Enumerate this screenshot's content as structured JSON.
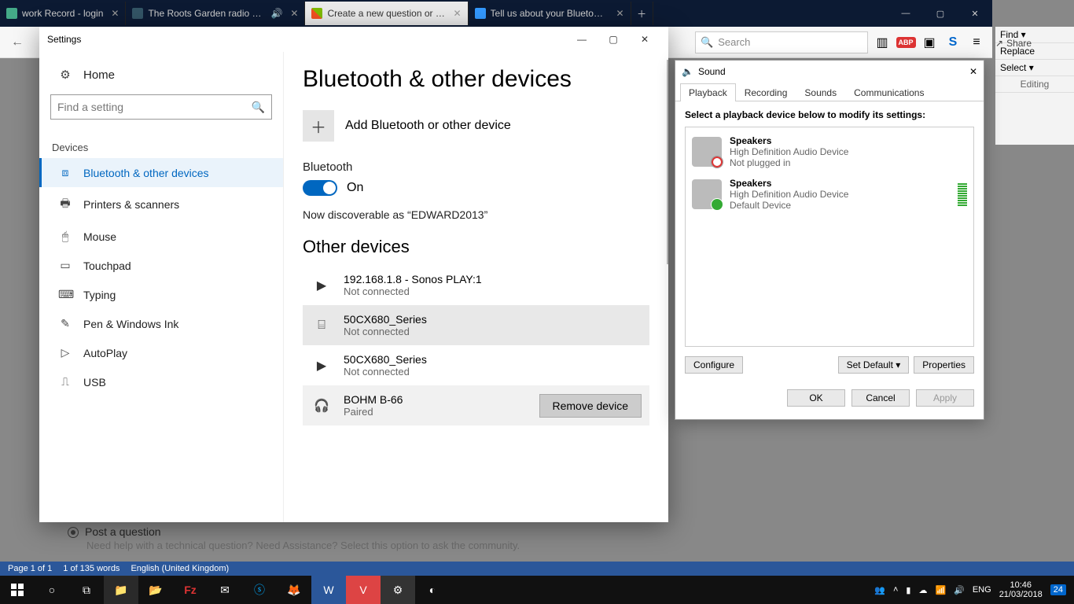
{
  "browser": {
    "tabs": [
      {
        "label": "work Record - login",
        "active": false
      },
      {
        "label": "The Roots Garden radio sho",
        "active": false,
        "audio": true
      },
      {
        "label": "Create a new question or start",
        "active": true
      },
      {
        "label": "Tell us about your Bluetooth pr",
        "active": false
      }
    ],
    "search_placeholder": "Search"
  },
  "word": {
    "share": "Share",
    "find": "Find",
    "replace": "Replace",
    "select": "Select",
    "editing": "Editing",
    "status_page": "Page 1 of 1",
    "status_words": "1 of 135 words",
    "status_lang": "English (United Kingdom)"
  },
  "settings": {
    "title": "Settings",
    "home": "Home",
    "search_placeholder": "Find a setting",
    "section": "Devices",
    "nav": [
      "Bluetooth & other devices",
      "Printers & scanners",
      "Mouse",
      "Touchpad",
      "Typing",
      "Pen & Windows Ink",
      "AutoPlay",
      "USB"
    ],
    "page_heading": "Bluetooth & other devices",
    "add_device": "Add Bluetooth or other device",
    "bt_header": "Bluetooth",
    "bt_state": "On",
    "discoverable": "Now discoverable as “EDWARD2013”",
    "other_header": "Other devices",
    "devices": [
      {
        "name": "192.168.1.8 - Sonos PLAY:1",
        "status": "Not connected"
      },
      {
        "name": "50CX680_Series",
        "status": "Not connected"
      },
      {
        "name": "50CX680_Series",
        "status": "Not connected"
      },
      {
        "name": "BOHM B-66",
        "status": "Paired"
      }
    ],
    "remove": "Remove device"
  },
  "post_question": {
    "title": "Post a question",
    "sub": "Need help with a technical question? Need Assistance? Select this option to ask the community."
  },
  "sound": {
    "title": "Sound",
    "tabs": [
      "Playback",
      "Recording",
      "Sounds",
      "Communications"
    ],
    "instructions": "Select a playback device below to modify its settings:",
    "devices": [
      {
        "name": "Speakers",
        "line2": "High Definition Audio Device",
        "line3": "Not plugged in",
        "badge": "down"
      },
      {
        "name": "Speakers",
        "line2": "High Definition Audio Device",
        "line3": "Default Device",
        "badge": "ok",
        "meter": true
      }
    ],
    "configure": "Configure",
    "setdefault": "Set Default",
    "properties": "Properties",
    "ok": "OK",
    "cancel": "Cancel",
    "apply": "Apply"
  },
  "taskbar": {
    "lang": "ENG",
    "time": "10:46",
    "date": "21/03/2018",
    "notify_count": "24"
  }
}
